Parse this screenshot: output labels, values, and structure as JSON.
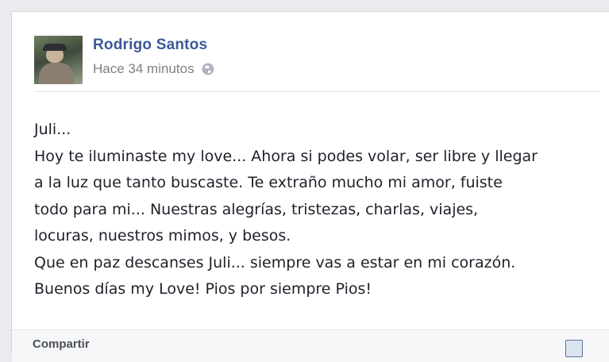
{
  "post": {
    "author": "Rodrigo Santos",
    "time": "Hace 34 minutos",
    "privacy_icon": "globe-icon",
    "lines": [
      "Juli...",
      "Hoy te iluminaste my love... Ahora si podes volar, ser libre y llegar",
      "a la luz que tanto buscaste. Te extraño mucho mi amor, fuiste",
      "todo para mi... Nuestras alegrías, tristezas, charlas, viajes,",
      "locuras, nuestros mimos, y besos.",
      "Que en paz descanses Juli... siempre vas a estar en mi corazón.",
      "Buenos días my Love! Pios por siempre Pios!"
    ]
  },
  "footer": {
    "label": "Compartir"
  },
  "colors": {
    "author_link": "#3b5998",
    "meta_text": "#7f7f7f",
    "body_text": "#1d2129"
  }
}
